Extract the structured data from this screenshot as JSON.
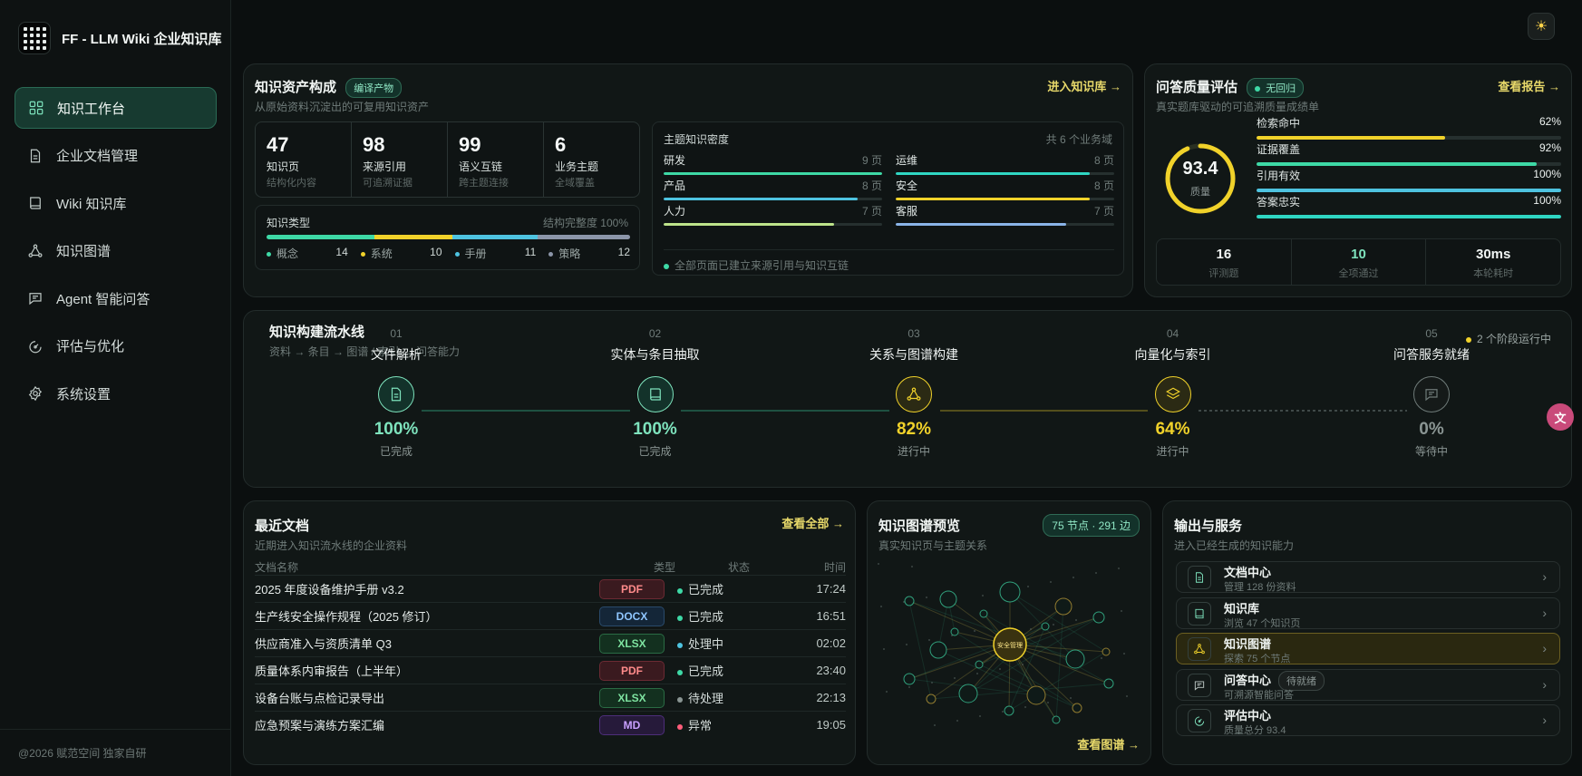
{
  "app": {
    "title": "FF - LLM Wiki 企业知识库",
    "footer": "@2026 赋范空间 独家自研"
  },
  "nav": [
    {
      "label": "知识工作台",
      "icon": "grid-icon",
      "active": true
    },
    {
      "label": "企业文档管理",
      "icon": "document-icon"
    },
    {
      "label": "Wiki 知识库",
      "icon": "book-icon"
    },
    {
      "label": "知识图谱",
      "icon": "graph-icon"
    },
    {
      "label": "Agent 智能问答",
      "icon": "chat-icon"
    },
    {
      "label": "评估与优化",
      "icon": "gauge-icon"
    },
    {
      "label": "系统设置",
      "icon": "gear-icon"
    }
  ],
  "assets": {
    "title": "知识资产构成",
    "badge": "编译产物",
    "subtitle": "从原始资料沉淀出的可复用知识资产",
    "link": "进入知识库 →",
    "stats": [
      {
        "value": "47",
        "label": "知识页",
        "sub": "结构化内容"
      },
      {
        "value": "98",
        "label": "来源引用",
        "sub": "可追溯证据"
      },
      {
        "value": "99",
        "label": "语义互链",
        "sub": "跨主题连接"
      },
      {
        "value": "6",
        "label": "业务主题",
        "sub": "全域覆盖"
      }
    ],
    "types_title": "知识类型",
    "types_meta": "结构完整度 100%",
    "types": [
      {
        "name": "概念",
        "count": "14",
        "color": "#3ed9a6",
        "pct": 0.298
      },
      {
        "name": "系统",
        "count": "10",
        "color": "#f1d22a",
        "pct": 0.213
      },
      {
        "name": "手册",
        "count": "11",
        "color": "#4ec3e0",
        "pct": 0.234
      },
      {
        "name": "策略",
        "count": "12",
        "color": "#8b95a8",
        "pct": 0.255
      }
    ],
    "density_title": "主题知识密度",
    "density_meta": "共 6 个业务域",
    "density": [
      {
        "name": "研发",
        "pages": "9 页",
        "pct": 1.0,
        "color": "#3ed9a6"
      },
      {
        "name": "运维",
        "pages": "8 页",
        "pct": 0.89,
        "color": "#2fd6c3"
      },
      {
        "name": "产品",
        "pages": "8 页",
        "pct": 0.89,
        "color": "#4ec3e0"
      },
      {
        "name": "安全",
        "pages": "8 页",
        "pct": 0.89,
        "color": "#f1d22a"
      },
      {
        "name": "人力",
        "pages": "7 页",
        "pct": 0.78,
        "color": "#bde38a"
      },
      {
        "name": "客服",
        "pages": "7 页",
        "pct": 0.78,
        "color": "#8ab4e8"
      }
    ],
    "density_note": "全部页面已建立来源引用与知识互链"
  },
  "qa": {
    "title": "问答质量评估",
    "badge": "无回归",
    "subtitle": "真实题库驱动的可追溯质量成绩单",
    "link": "查看报告 →",
    "score": "93.4",
    "score_label": "质量",
    "score_frac": 0.934,
    "metrics": [
      {
        "name": "检索命中",
        "value": "62%",
        "pct": 0.62,
        "color": "#f1d22a"
      },
      {
        "name": "证据覆盖",
        "value": "92%",
        "pct": 0.92,
        "color": "#3ed9a6"
      },
      {
        "name": "引用有效",
        "value": "100%",
        "pct": 1.0,
        "color": "#4ec3e0"
      },
      {
        "name": "答案忠实",
        "value": "100%",
        "pct": 1.0,
        "color": "#2fd6c3"
      }
    ],
    "bottom": [
      {
        "value": "16",
        "label": "评测题",
        "color": "#f1f5f4"
      },
      {
        "value": "10",
        "label": "全项通过",
        "color": "#7ee3bd"
      },
      {
        "value": "30ms",
        "label": "本轮耗时",
        "color": "#f1f5f4"
      }
    ]
  },
  "pipeline": {
    "title": "知识构建流水线",
    "subtitle": "资料 → 条目 → 图谱 / 索引 → 问答能力",
    "status": "2 个阶段运行中",
    "steps": [
      {
        "no": "01",
        "name": "文件解析",
        "pct": "100%",
        "state": "已完成",
        "icon": "document-icon",
        "color": "#7ee3bd"
      },
      {
        "no": "02",
        "name": "实体与条目抽取",
        "pct": "100%",
        "state": "已完成",
        "icon": "book-icon",
        "color": "#7ee3bd"
      },
      {
        "no": "03",
        "name": "关系与图谱构建",
        "pct": "82%",
        "state": "进行中",
        "icon": "graph-icon",
        "color": "#f1d22a"
      },
      {
        "no": "04",
        "name": "向量化与索引",
        "pct": "64%",
        "state": "进行中",
        "icon": "layers-icon",
        "color": "#f1d22a"
      },
      {
        "no": "05",
        "name": "问答服务就绪",
        "pct": "0%",
        "state": "等待中",
        "icon": "chat-icon",
        "color": "#6f7b79"
      }
    ]
  },
  "docs": {
    "title": "最近文档",
    "subtitle": "近期进入知识流水线的企业资料",
    "link": "查看全部 →",
    "headers": [
      "文档名称",
      "类型",
      "状态",
      "时间"
    ],
    "rows": [
      {
        "name": "2025 年度设备维护手册 v3.2",
        "type": "PDF",
        "status": "已完成",
        "time": "17:24"
      },
      {
        "name": "生产线安全操作规程（2025 修订）",
        "type": "DOCX",
        "status": "已完成",
        "time": "16:51"
      },
      {
        "name": "供应商准入与资质清单 Q3",
        "type": "XLSX",
        "status": "处理中",
        "time": "02:02"
      },
      {
        "name": "质量体系内审报告（上半年）",
        "type": "PDF",
        "status": "已完成",
        "time": "23:40"
      },
      {
        "name": "设备台账与点检记录导出",
        "type": "XLSX",
        "status": "待处理",
        "time": "22:13"
      },
      {
        "name": "应急预案与演练方案汇编",
        "type": "MD",
        "status": "异常",
        "time": "19:05"
      }
    ]
  },
  "graph": {
    "title": "知识图谱预览",
    "subtitle": "真实知识页与主题关系",
    "badge": "75 节点 · 291 边",
    "link": "查看图谱 →",
    "center": "安全管理"
  },
  "services": {
    "title": "输出与服务",
    "subtitle": "进入已经生成的知识能力",
    "items": [
      {
        "title": "文档中心",
        "desc": "管理 128 份资料",
        "icon": "document-icon",
        "color": "#7ee3bd"
      },
      {
        "title": "知识库",
        "desc": "浏览 47 个知识页",
        "icon": "book-icon",
        "color": "#7ee3bd"
      },
      {
        "title": "知识图谱",
        "desc": "探索 75 个节点",
        "icon": "graph-icon",
        "color": "#f1d22a",
        "active": true
      },
      {
        "title": "问答中心",
        "desc": "可溯源智能问答",
        "icon": "chat-icon",
        "color": "#bfc9c6",
        "badge": "待就绪"
      },
      {
        "title": "评估中心",
        "desc": "质量总分 93.4",
        "icon": "gauge-icon",
        "color": "#7ee3bd"
      }
    ]
  }
}
